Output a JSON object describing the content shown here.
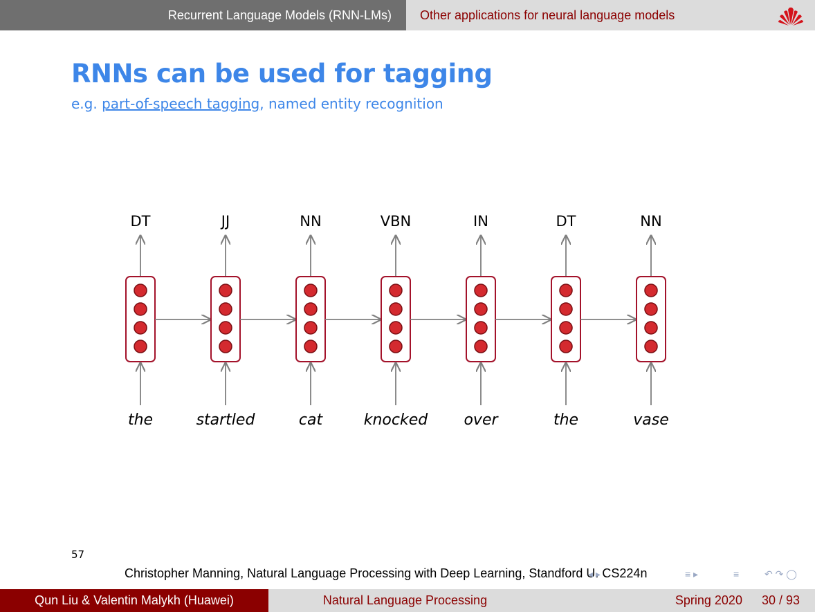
{
  "header": {
    "section_left": "Recurrent Language Models (RNN-LMs)",
    "section_right": "Other applications for neural language models"
  },
  "slide": {
    "title": "RNNs can be used for tagging",
    "subtitle_prefix": "e.g. ",
    "subtitle_link": "part-of-speech tagging",
    "subtitle_suffix": ", named entity recognition"
  },
  "diagram": {
    "steps": [
      {
        "tag": "DT",
        "word": "the"
      },
      {
        "tag": "JJ",
        "word": "startled"
      },
      {
        "tag": "NN",
        "word": "cat"
      },
      {
        "tag": "VBN",
        "word": "knocked"
      },
      {
        "tag": "IN",
        "word": "over"
      },
      {
        "tag": "DT",
        "word": "the"
      },
      {
        "tag": "NN",
        "word": "vase"
      }
    ],
    "units_per_cell": 4,
    "colors": {
      "cell_border": "#a3122a",
      "unit_fill": "#d42a2f",
      "arrow": "#7f7f7f"
    }
  },
  "slide_number": "57",
  "credit": "Christopher Manning, Natural Language Processing with Deep Learning, Standford U. CS224n",
  "footer": {
    "authors": "Qun Liu & Valentin Malykh  (Huawei)",
    "course": "Natural Language Processing",
    "term": "Spring 2020",
    "page": "30 / 93"
  },
  "theme": {
    "accent": "#8b0000",
    "title_blue": "#3d86e8",
    "bar_gray": "#6f6f6f",
    "light_gray": "#dcdcdc"
  }
}
